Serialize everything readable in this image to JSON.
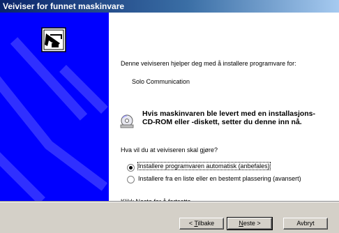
{
  "window": {
    "title": "Veiviser for funnet maskinvare"
  },
  "wizard": {
    "intro": "Denne veiviseren hjelper deg med å installere programvare for:",
    "device": "Solo Communication",
    "cd_notice": "Hvis maskinvaren ble levert med en installasjons-CD-ROM eller -diskett, setter du denne inn nå.",
    "question": "Hva vil du at veiviseren skal gjøre?",
    "options": [
      {
        "label": "Installere programvaren automatisk (anbefales)",
        "selected": true
      },
      {
        "label": "Installere fra en liste eller en bestemt plassering (avansert)",
        "selected": false
      }
    ],
    "footer_hint": "Klikk Neste for å fortsette."
  },
  "buttons": {
    "back": {
      "before": "< ",
      "mnemonic": "T",
      "after": "ilbake"
    },
    "next": {
      "mnemonic": "N",
      "after": "este >"
    },
    "cancel": "Avbryt"
  },
  "icons": [
    "hardware-wizard-icon",
    "cd-icon"
  ],
  "colors": {
    "title_start": "#0a246a",
    "title_end": "#a6caf0",
    "side_panel": "#0000ff",
    "dialog_bg": "#d4d0c8"
  }
}
